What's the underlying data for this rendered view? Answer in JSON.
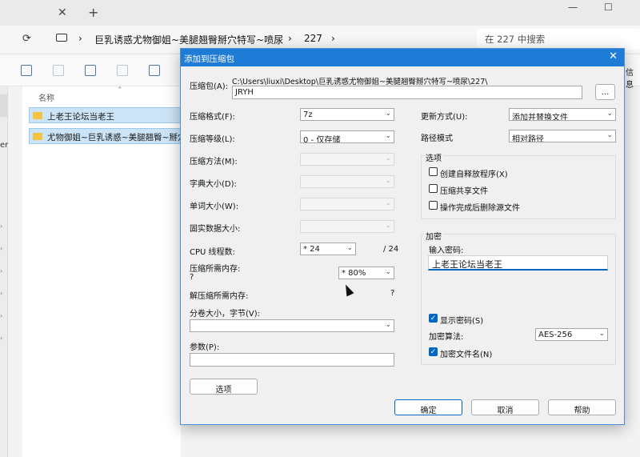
{
  "explorer": {
    "tab_close": "✕",
    "tab_new": "+",
    "window_minimize": "—",
    "window_maximize": "☐",
    "breadcrumb": [
      "巨乳诱惑尤物御姐~美腿翘臀掰穴特写~喷尿",
      "227"
    ],
    "search_placeholder": "在 227 中搜索",
    "toolbar_right_text": "信息",
    "column_name": "名称",
    "sidebar_text": "er",
    "files": [
      "上老王论坛当老王",
      "尤物御姐~巨乳诱惑~美腿翘臀~掰穴特写"
    ]
  },
  "dialog": {
    "title": "添加到压缩包",
    "close": "✕",
    "archive_label": "压缩包(A):",
    "archive_path": "C:\\Users\\liuxi\\Desktop\\巨乳诱惑尤物御姐~美腿翘臀掰穴特写~喷尿\\227\\",
    "archive_name": "JRYH",
    "browse_label": "...",
    "format_label": "压缩格式(F):",
    "format_value": "7z",
    "level_label": "压缩等级(L):",
    "level_value": "0 - 仅存储",
    "method_label": "压缩方法(M):",
    "dict_label": "字典大小(D):",
    "word_label": "单词大小(W):",
    "solid_label": "固实数据大小:",
    "cpu_label": "CPU 线程数:",
    "cpu_value": "* 24",
    "cpu_max": "/ 24",
    "mem_comp_label": "压缩所需内存:",
    "mem_comp_value": "?",
    "mem_pct_value": "* 80%",
    "mem_decomp_label": "解压缩所需内存:",
    "mem_decomp_value": "?",
    "split_label": "分卷大小，字节(V):",
    "split_value": "",
    "params_label": "参数(P):",
    "params_value": "",
    "options_button": "选项",
    "update_label": "更新方式(U):",
    "update_value": "添加并替换文件",
    "path_label": "路径模式",
    "path_value": "相对路径",
    "options_group": "选项",
    "opt_sfx": "创建自释放程序(X)",
    "opt_shared": "压缩共享文件",
    "opt_delete": "操作完成后删除源文件",
    "encrypt_group": "加密",
    "password_label": "输入密码:",
    "password_value": "上老王论坛当老王",
    "show_password": "显示密码(S)",
    "enc_method_label": "加密算法:",
    "enc_method_value": "AES-256",
    "enc_names": "加密文件名(N)",
    "ok": "确定",
    "cancel": "取消",
    "help": "帮助",
    "check_mark": "✓",
    "arrow": "⌄"
  }
}
